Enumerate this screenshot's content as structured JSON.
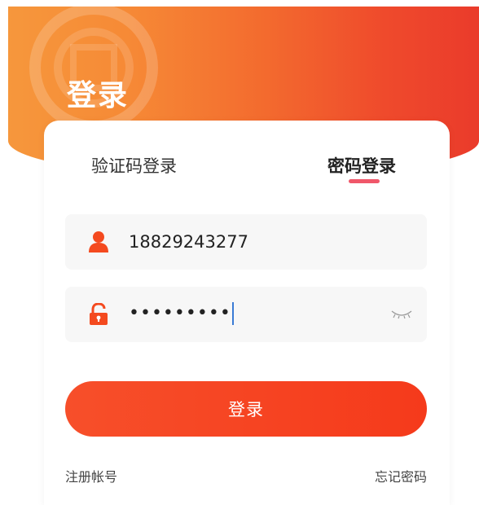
{
  "page": {
    "title": "登录"
  },
  "tabs": [
    {
      "label": "验证码登录",
      "active": false
    },
    {
      "label": "密码登录",
      "active": true
    }
  ],
  "form": {
    "phone_value": "18829243277",
    "password_masked": "•••••••••"
  },
  "buttons": {
    "login_label": "登录"
  },
  "links": {
    "register": "注册帐号",
    "forgot_password": "忘记密码"
  },
  "icons": {
    "phone": "user-icon",
    "password": "lock-icon",
    "toggle": "eye-closed-icon"
  },
  "colors": {
    "brand_orange": "#f6973c",
    "brand_red": "#ea3b2b",
    "button": "#f53a1b",
    "tab_underline": "#f0576a",
    "field_bg": "#f7f7f7"
  }
}
